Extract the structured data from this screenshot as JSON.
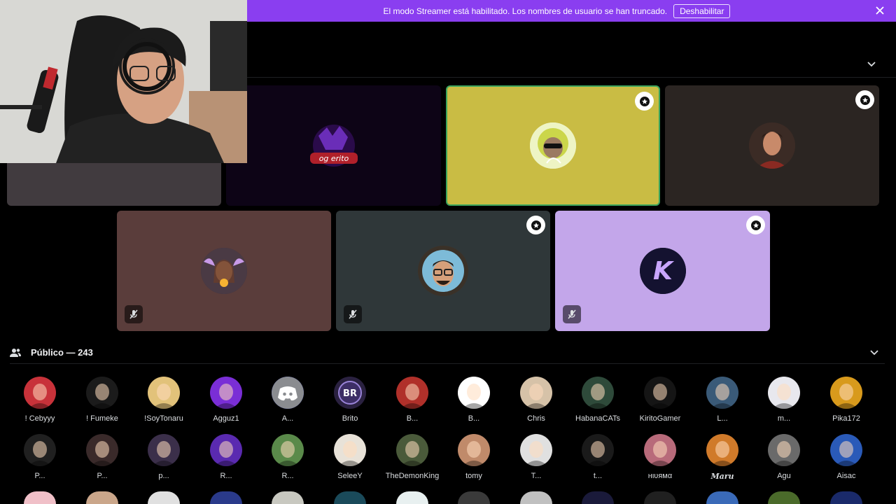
{
  "banner": {
    "message": "El modo Streamer está habilitado. Los nombres de usuario se han truncado.",
    "disable_label": "Deshabilitar"
  },
  "stage": {
    "tiles_top": [
      {
        "name": "hidden-user",
        "bg": "#413b3f"
      },
      {
        "name": "og-erito",
        "bg": "#0d0416",
        "logo_text": "og erito"
      },
      {
        "name": "yellow-speaker",
        "bg": "#c9bc44",
        "speaking": true
      },
      {
        "name": "dark-user",
        "bg": "#2b2522"
      }
    ],
    "tiles_bottom": [
      {
        "name": "fairy-user",
        "bg": "#5a3d3b",
        "muted": true
      },
      {
        "name": "glasses-user",
        "bg": "#2f3739",
        "muted": true
      },
      {
        "name": "k-user",
        "bg": "#c3a6ea",
        "muted": true
      }
    ]
  },
  "audience": {
    "title": "Público — 243",
    "row1": [
      "! Cebyyy",
      "! Fumeke",
      "!SoyTonaru",
      "Agguz1",
      "A...",
      "Brito",
      "B...",
      "B...",
      "Chris",
      "HabanaCATs",
      "KiritoGamer",
      "L...",
      "m...",
      "Pika172"
    ],
    "row2": [
      "P...",
      "P...",
      "p...",
      "R...",
      "R...",
      "SeleeY",
      "TheDemonKing",
      "tomy",
      "T...",
      "t...",
      "нιυямα",
      "Maru",
      "Agu",
      "Aisac"
    ]
  },
  "colors": {
    "banner": "#8a3ef0",
    "speaking_ring": "#3ba55d",
    "background": "#000000"
  },
  "icons": {
    "close": "close-icon",
    "chevron": "chevron-down-icon",
    "audience": "people-icon",
    "mute": "mic-muted-icon",
    "stage_badge": "shield-star-icon"
  }
}
